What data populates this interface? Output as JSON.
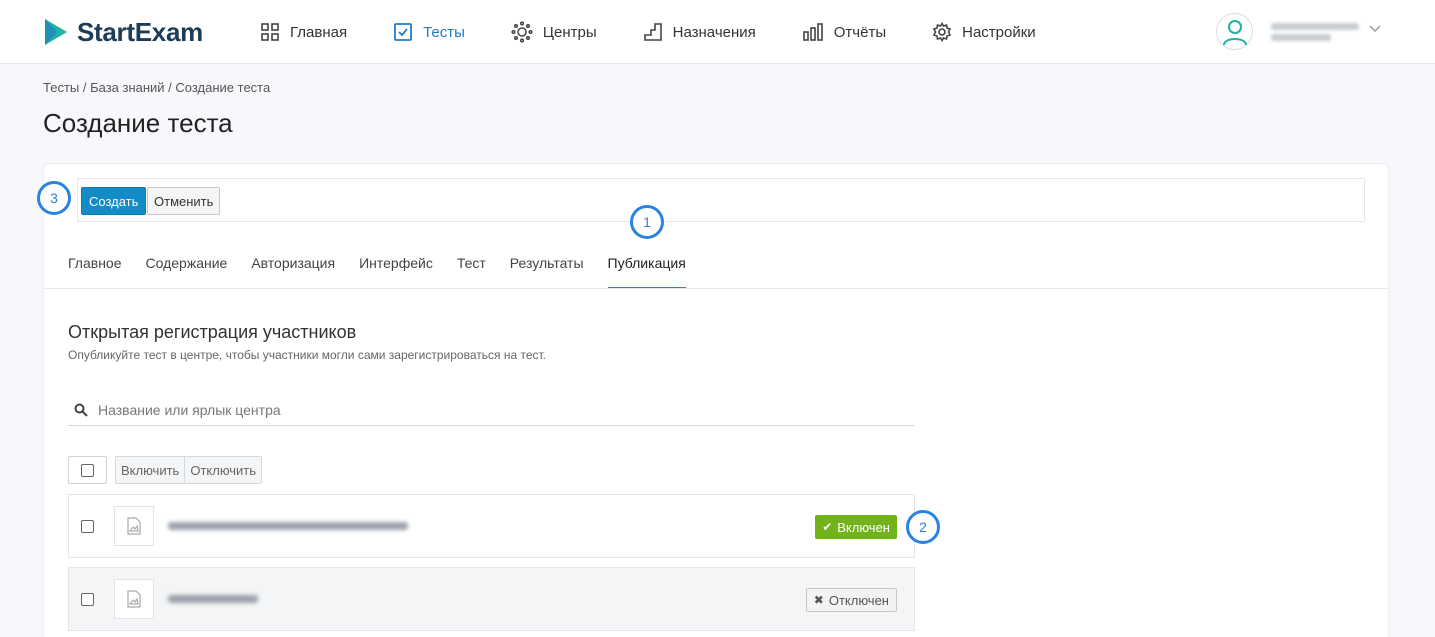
{
  "header": {
    "brand": "StartExam",
    "nav": [
      {
        "label": "Главная",
        "icon": "grid-icon"
      },
      {
        "label": "Тесты",
        "icon": "checkbox-icon",
        "active": true
      },
      {
        "label": "Центры",
        "icon": "sun-icon"
      },
      {
        "label": "Назначения",
        "icon": "stairs-icon"
      },
      {
        "label": "Отчёты",
        "icon": "bar-chart-icon"
      },
      {
        "label": "Настройки",
        "icon": "gear-icon"
      }
    ],
    "user": {
      "icon": "user-icon"
    },
    "colors": {
      "accent": "#1f7ec2",
      "brand_dark": "#1d3c58",
      "brand_teal": "#1fb3a5"
    }
  },
  "breadcrumb": "Тесты / База знаний / Создание теста",
  "page_title": "Создание теста",
  "toolbar": {
    "create_label": "Создать",
    "cancel_label": "Отменить"
  },
  "tabs": [
    {
      "label": "Главное"
    },
    {
      "label": "Содержание"
    },
    {
      "label": "Авторизация"
    },
    {
      "label": "Интерфейс"
    },
    {
      "label": "Тест"
    },
    {
      "label": "Результаты"
    },
    {
      "label": "Публикация",
      "active": true
    }
  ],
  "section": {
    "title": "Открытая регистрация участников",
    "description": "Опубликуйте тест в центре, чтобы участники могли сами зарегистрироваться на тест."
  },
  "search": {
    "placeholder": "Название или ярлык центра"
  },
  "bulk": {
    "enable_label": "Включить",
    "disable_label": "Отключить"
  },
  "centers": [
    {
      "status": "Включен",
      "enabled": true
    },
    {
      "status": "Отключен",
      "enabled": false
    }
  ],
  "markers": [
    "1",
    "2",
    "3"
  ]
}
